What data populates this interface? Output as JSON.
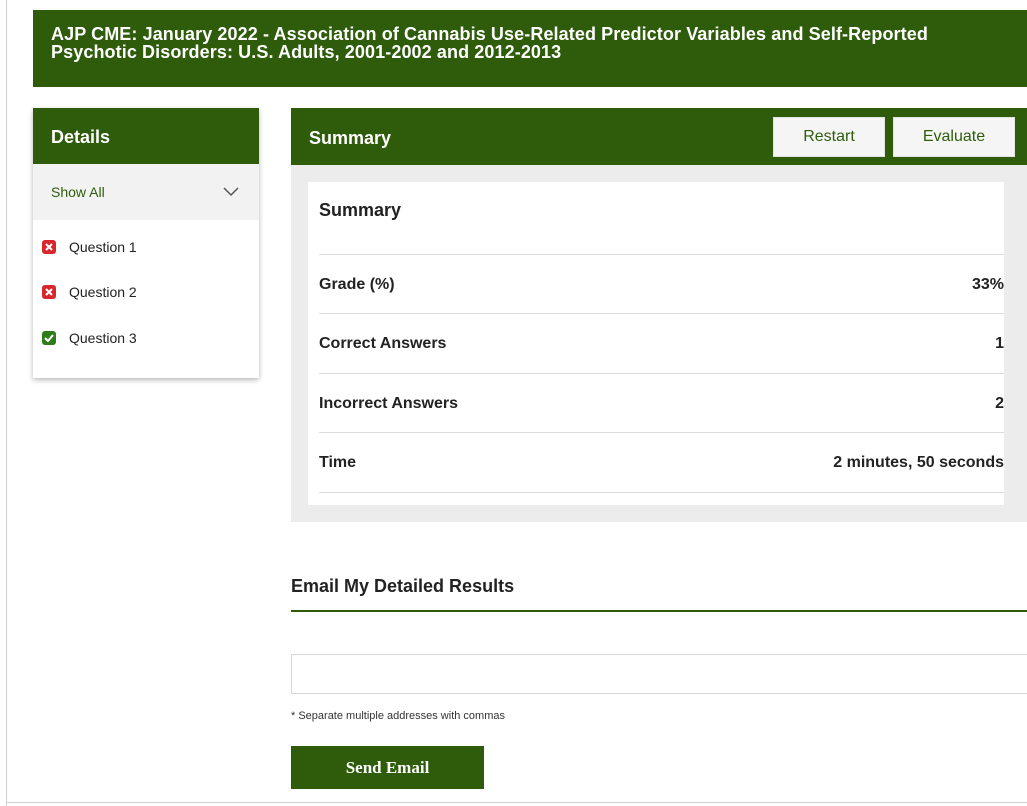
{
  "header": {
    "title": "AJP CME: January 2022 - Association of Cannabis Use-Related Predictor Variables and Self-Reported Psychotic Disorders: U.S. Adults, 2001-2002 and 2012-2013"
  },
  "sidebar": {
    "title": "Details",
    "filter": "Show All",
    "questions": [
      {
        "label": "Question 1",
        "status": "incorrect"
      },
      {
        "label": "Question 2",
        "status": "incorrect"
      },
      {
        "label": "Question 3",
        "status": "correct"
      }
    ]
  },
  "summary_bar": {
    "title": "Summary",
    "restart_label": "Restart",
    "evaluate_label": "Evaluate"
  },
  "summary_card": {
    "title": "Summary",
    "rows": [
      {
        "label": "Grade (%)",
        "value": "33%"
      },
      {
        "label": "Correct Answers",
        "value": "1"
      },
      {
        "label": "Incorrect Answers",
        "value": "2"
      },
      {
        "label": "Time",
        "value": "2 minutes, 50 seconds"
      }
    ]
  },
  "email": {
    "heading": "Email My Detailed Results",
    "input_value": "",
    "note": "* Separate multiple addresses with commas",
    "send_label": "Send Email"
  },
  "colors": {
    "brand_green": "#2f5c0b",
    "incorrect_red": "#d9262c",
    "correct_green": "#2f7d1a"
  }
}
